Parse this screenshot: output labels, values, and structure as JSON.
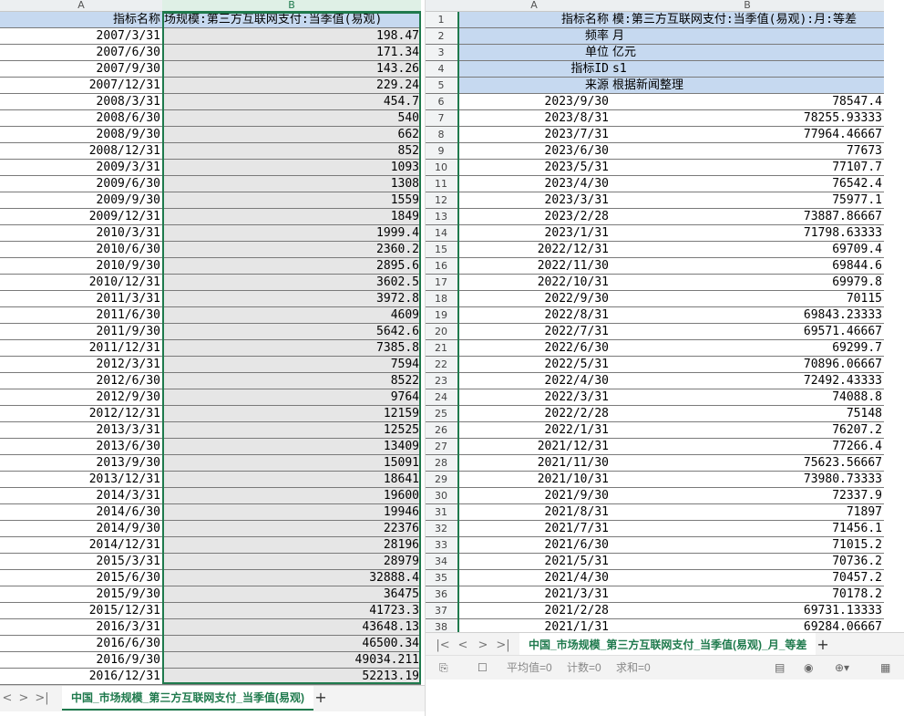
{
  "left": {
    "col_a": "A",
    "col_b": "B",
    "header_a": "指标名称",
    "header_b": "场规模:第三方互联网支付:当季值(易观)",
    "rows": [
      [
        "2007/3/31",
        "198.47"
      ],
      [
        "2007/6/30",
        "171.34"
      ],
      [
        "2007/9/30",
        "143.26"
      ],
      [
        "2007/12/31",
        "229.24"
      ],
      [
        "2008/3/31",
        "454.7"
      ],
      [
        "2008/6/30",
        "540"
      ],
      [
        "2008/9/30",
        "662"
      ],
      [
        "2008/12/31",
        "852"
      ],
      [
        "2009/3/31",
        "1093"
      ],
      [
        "2009/6/30",
        "1308"
      ],
      [
        "2009/9/30",
        "1559"
      ],
      [
        "2009/12/31",
        "1849"
      ],
      [
        "2010/3/31",
        "1999.4"
      ],
      [
        "2010/6/30",
        "2360.2"
      ],
      [
        "2010/9/30",
        "2895.6"
      ],
      [
        "2010/12/31",
        "3602.5"
      ],
      [
        "2011/3/31",
        "3972.8"
      ],
      [
        "2011/6/30",
        "4609"
      ],
      [
        "2011/9/30",
        "5642.6"
      ],
      [
        "2011/12/31",
        "7385.8"
      ],
      [
        "2012/3/31",
        "7594"
      ],
      [
        "2012/6/30",
        "8522"
      ],
      [
        "2012/9/30",
        "9764"
      ],
      [
        "2012/12/31",
        "12159"
      ],
      [
        "2013/3/31",
        "12525"
      ],
      [
        "2013/6/30",
        "13409"
      ],
      [
        "2013/9/30",
        "15091"
      ],
      [
        "2013/12/31",
        "18641"
      ],
      [
        "2014/3/31",
        "19600"
      ],
      [
        "2014/6/30",
        "19946"
      ],
      [
        "2014/9/30",
        "22376"
      ],
      [
        "2014/12/31",
        "28196"
      ],
      [
        "2015/3/31",
        "28979"
      ],
      [
        "2015/6/30",
        "32888.4"
      ],
      [
        "2015/9/30",
        "36475"
      ],
      [
        "2015/12/31",
        "41723.3"
      ],
      [
        "2016/3/31",
        "43648.13"
      ],
      [
        "2016/6/30",
        "46500.34"
      ],
      [
        "2016/9/30",
        "49034.211"
      ],
      [
        "2016/12/31",
        "52213.19"
      ]
    ],
    "tab": "中国_市场规模_第三方互联网支付_当季值(易观)",
    "add": "+",
    "nav": [
      "<",
      ">",
      ">|"
    ]
  },
  "right": {
    "col_a": "A",
    "col_b": "B",
    "meta": [
      [
        "1",
        "指标名称",
        "模:第三方互联网支付:当季值(易观):月:等差"
      ],
      [
        "2",
        "频率",
        "月"
      ],
      [
        "3",
        "单位",
        "亿元"
      ],
      [
        "4",
        "指标ID",
        "s1"
      ],
      [
        "5",
        "来源",
        "根据新闻整理"
      ]
    ],
    "rows": [
      [
        "6",
        "2023/9/30",
        "78547.4"
      ],
      [
        "7",
        "2023/8/31",
        "78255.93333"
      ],
      [
        "8",
        "2023/7/31",
        "77964.46667"
      ],
      [
        "9",
        "2023/6/30",
        "77673"
      ],
      [
        "10",
        "2023/5/31",
        "77107.7"
      ],
      [
        "11",
        "2023/4/30",
        "76542.4"
      ],
      [
        "12",
        "2023/3/31",
        "75977.1"
      ],
      [
        "13",
        "2023/2/28",
        "73887.86667"
      ],
      [
        "14",
        "2023/1/31",
        "71798.63333"
      ],
      [
        "15",
        "2022/12/31",
        "69709.4"
      ],
      [
        "16",
        "2022/11/30",
        "69844.6"
      ],
      [
        "17",
        "2022/10/31",
        "69979.8"
      ],
      [
        "18",
        "2022/9/30",
        "70115"
      ],
      [
        "19",
        "2022/8/31",
        "69843.23333"
      ],
      [
        "20",
        "2022/7/31",
        "69571.46667"
      ],
      [
        "21",
        "2022/6/30",
        "69299.7"
      ],
      [
        "22",
        "2022/5/31",
        "70896.06667"
      ],
      [
        "23",
        "2022/4/30",
        "72492.43333"
      ],
      [
        "24",
        "2022/3/31",
        "74088.8"
      ],
      [
        "25",
        "2022/2/28",
        "75148"
      ],
      [
        "26",
        "2022/1/31",
        "76207.2"
      ],
      [
        "27",
        "2021/12/31",
        "77266.4"
      ],
      [
        "28",
        "2021/11/30",
        "75623.56667"
      ],
      [
        "29",
        "2021/10/31",
        "73980.73333"
      ],
      [
        "30",
        "2021/9/30",
        "72337.9"
      ],
      [
        "31",
        "2021/8/31",
        "71897"
      ],
      [
        "32",
        "2021/7/31",
        "71456.1"
      ],
      [
        "33",
        "2021/6/30",
        "71015.2"
      ],
      [
        "34",
        "2021/5/31",
        "70736.2"
      ],
      [
        "35",
        "2021/4/30",
        "70457.2"
      ],
      [
        "36",
        "2021/3/31",
        "70178.2"
      ],
      [
        "37",
        "2021/2/28",
        "69731.13333"
      ],
      [
        "38",
        "2021/1/31",
        "69284.06667"
      ]
    ],
    "tab": "中国_市场规模_第三方互联网支付_当季值(易观)_月_等差",
    "add": "+",
    "nav": [
      "|<",
      "<",
      ">",
      ">|"
    ],
    "status": {
      "avg": "平均值=0",
      "count": "计数=0",
      "sum": "求和=0"
    }
  }
}
